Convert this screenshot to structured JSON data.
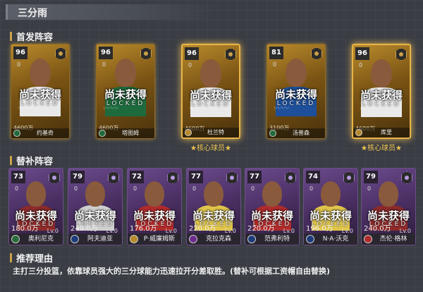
{
  "header": {
    "title": "三分雨"
  },
  "starters_section": {
    "title": "首发阵容"
  },
  "bench_section": {
    "title": "替补阵容"
  },
  "reason_section": {
    "title": "推荐理由",
    "text": "主打三分投篮，依靠球员强大的三分球能力迅速拉开分差取胜。(替补可根据工资帽自由替换)"
  },
  "locked_cn": "尚未获得",
  "locked_en": "LOCKED",
  "core_label": "★核心球员★",
  "starters": [
    {
      "rating": "96",
      "sub": "0",
      "salary": "4600万",
      "name": "约基奇",
      "core": false,
      "jersey": "#e9e9e9",
      "team_color": "#1f6b3a"
    },
    {
      "rating": "96",
      "sub": "0",
      "salary": "4600万",
      "name": "塔图姆",
      "core": false,
      "jersey": "#1d6b3d",
      "team_color": "#1f6b3a"
    },
    {
      "rating": "96",
      "sub": "0",
      "salary": "4600万",
      "name": "杜兰特",
      "core": true,
      "jersey": "#e9e9e9",
      "team_color": "#b78a2a"
    },
    {
      "rating": "81",
      "sub": "0",
      "salary": "3100万",
      "name": "汤普森",
      "core": false,
      "jersey": "#1d4f9a",
      "team_color": "#1f6b3a"
    },
    {
      "rating": "96",
      "sub": "0",
      "salary": "4600万",
      "name": "库里",
      "core": true,
      "jersey": "#e9e9e9",
      "team_color": "#b78a2a"
    }
  ],
  "bench": [
    {
      "rating": "73",
      "sub": "0",
      "salary": "180.0万",
      "lv": "Lv.0",
      "name": "奥利尼克",
      "jersey": "#8c2b2b",
      "team_color": "#2a6d3b"
    },
    {
      "rating": "79",
      "sub": "0",
      "salary": "240.0万",
      "lv": "Lv.0",
      "name": "阿夫迪亚",
      "jersey": "#cfcfcf",
      "team_color": "#1d3c7a"
    },
    {
      "rating": "72",
      "sub": "0",
      "salary": "176.0万",
      "lv": "Lv.0",
      "name": "P·威廉姆斯",
      "jersey": "#b02b2b",
      "team_color": "#b78a2a"
    },
    {
      "rating": "77",
      "sub": "0",
      "salary": "220.0万",
      "lv": "Lv.0",
      "name": "克拉克森",
      "jersey": "#e0c54a",
      "team_color": "#6b2b8c"
    },
    {
      "rating": "77",
      "sub": "0",
      "salary": "220.0万",
      "lv": "Lv.0",
      "name": "范弗利特",
      "jersey": "#b02b2b",
      "team_color": "#1d3c7a"
    },
    {
      "rating": "74",
      "sub": "0",
      "salary": "196.0万",
      "lv": "Lv.0",
      "name": "N·A·沃克",
      "jersey": "#e0c54a",
      "team_color": "#1d3c7a"
    },
    {
      "rating": "79",
      "sub": "0",
      "salary": "240.0万",
      "lv": "Lv.0",
      "name": "杰伦·格林",
      "jersey": "#8c2b2b",
      "team_color": "#b02b2b"
    }
  ]
}
